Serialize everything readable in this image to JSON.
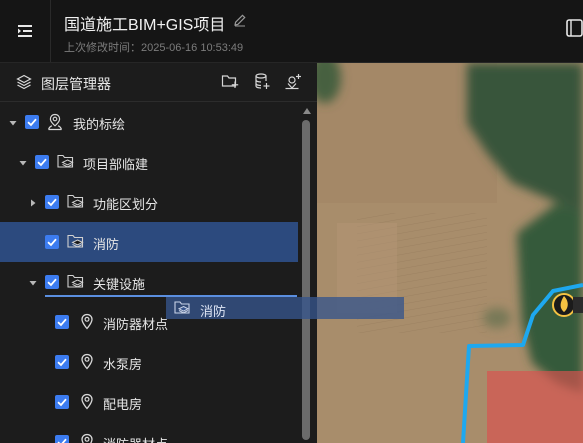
{
  "header": {
    "title": "国道施工BIM+GIS项目",
    "subtitle": "上次修改时间：2025-06-16 10:53:49"
  },
  "panel": {
    "title": "图层管理器",
    "tools": [
      "new-folder-icon",
      "database-icon",
      "add-marker-icon"
    ]
  },
  "tree": [
    {
      "label": "我的标绘",
      "level": 0,
      "expanded": true,
      "icon": "user-pin-icon",
      "checked": true
    },
    {
      "label": "项目部临建",
      "level": 1,
      "expanded": true,
      "icon": "layer-folder-icon",
      "checked": true
    },
    {
      "label": "功能区划分",
      "level": 2,
      "expanded": false,
      "icon": "layer-folder-icon",
      "checked": true
    },
    {
      "label": "消防",
      "level": 2,
      "expanded": null,
      "icon": "layer-folder-icon",
      "checked": true,
      "selected": true
    },
    {
      "label": "关键设施",
      "level": 2,
      "expanded": true,
      "icon": "layer-folder-icon",
      "checked": true
    },
    {
      "label": "消防器材点",
      "level": 3,
      "icon": "location-pin-icon",
      "checked": true
    },
    {
      "label": "水泵房",
      "level": 3,
      "icon": "location-pin-icon",
      "checked": true
    },
    {
      "label": "配电房",
      "level": 3,
      "icon": "location-pin-icon",
      "checked": true
    },
    {
      "label": "消防器材点",
      "level": 3,
      "icon": "location-pin-icon",
      "checked": true
    }
  ],
  "drag": {
    "label": "消防"
  },
  "colors": {
    "accent": "#3c7cf0",
    "selected_row": "#2c4a7e",
    "panel_bg": "#1c1c1c",
    "header_bg": "#151515",
    "route_line": "#1ea8ef",
    "zone_fill": "#d9534f"
  }
}
